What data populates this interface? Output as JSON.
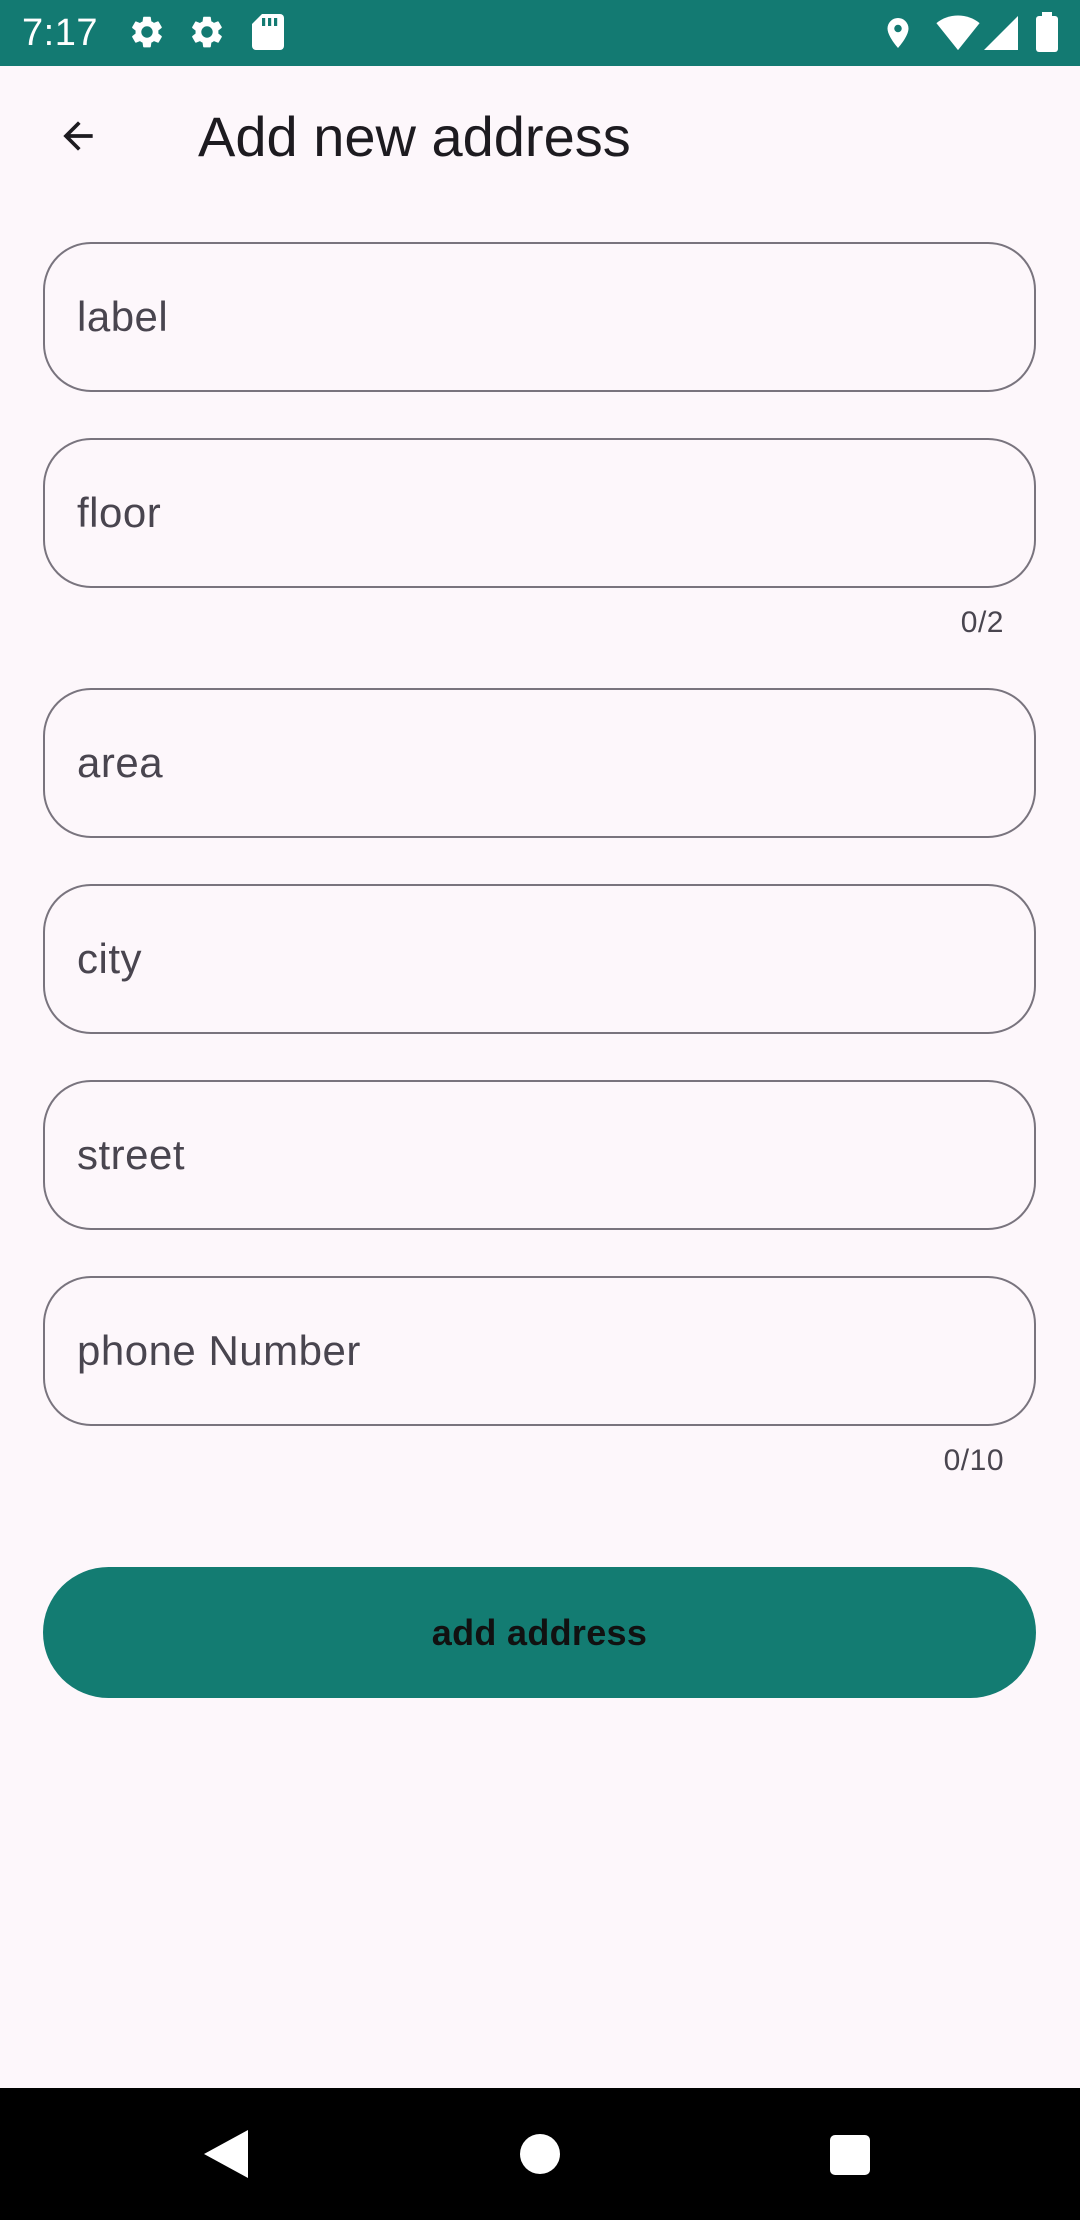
{
  "status_bar": {
    "time": "7:17",
    "icons": [
      "gear-icon",
      "gear-icon",
      "sd-card-icon",
      "location-icon",
      "wifi-icon",
      "signal-icon",
      "battery-icon"
    ],
    "background": "#137a72"
  },
  "header": {
    "title": "Add new address",
    "back_icon": "arrow-back-icon"
  },
  "form": {
    "fields": [
      {
        "name": "label",
        "placeholder": "label",
        "value": ""
      },
      {
        "name": "floor",
        "placeholder": "floor",
        "value": "",
        "counter": "0/2"
      },
      {
        "name": "area",
        "placeholder": "area",
        "value": ""
      },
      {
        "name": "city",
        "placeholder": "city",
        "value": ""
      },
      {
        "name": "street",
        "placeholder": "street",
        "value": ""
      },
      {
        "name": "phone",
        "placeholder": "phone Number",
        "value": "",
        "counter": "0/10"
      }
    ],
    "submit_label": "add address",
    "accent_color": "#137c72"
  },
  "nav_bar": {
    "buttons": [
      "back-triangle-icon",
      "home-circle-icon",
      "recents-square-icon"
    ]
  }
}
